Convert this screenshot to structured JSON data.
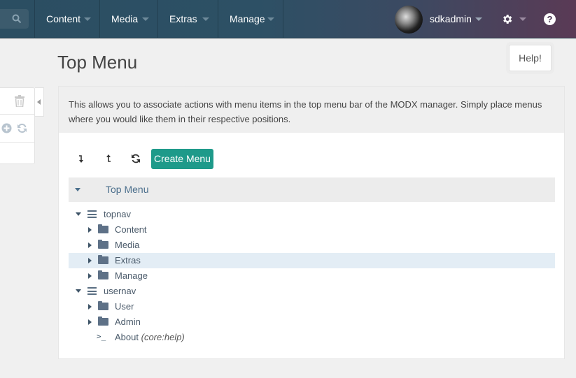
{
  "topbar": {
    "nav": [
      {
        "label": "Content"
      },
      {
        "label": "Media"
      },
      {
        "label": "Extras"
      },
      {
        "label": "Manage"
      }
    ],
    "username": "sdkadmin",
    "help_symbol": "?"
  },
  "page": {
    "title": "Top Menu",
    "help_button": "Help!",
    "description": "This allows you to associate actions with menu items in the top menu bar of the MODX manager. Simply place menus where you would like them in their respective positions."
  },
  "toolbar": {
    "create_menu_label": "Create Menu"
  },
  "tree": {
    "root_label": "Top Menu",
    "nodes": [
      {
        "label": "topnav",
        "type": "menu",
        "expanded": true
      },
      {
        "label": "Content",
        "type": "folder"
      },
      {
        "label": "Media",
        "type": "folder"
      },
      {
        "label": "Extras",
        "type": "folder",
        "selected": true
      },
      {
        "label": "Manage",
        "type": "folder"
      },
      {
        "label": "usernav",
        "type": "menu",
        "expanded": true
      },
      {
        "label": "User",
        "type": "folder"
      },
      {
        "label": "Admin",
        "type": "folder"
      },
      {
        "label": "About",
        "suffix": "(core:help)",
        "type": "action"
      }
    ]
  },
  "colors": {
    "accent": "#1e9a8a",
    "tree_text": "#4b6f8c",
    "selected_row": "#e3edf5"
  }
}
